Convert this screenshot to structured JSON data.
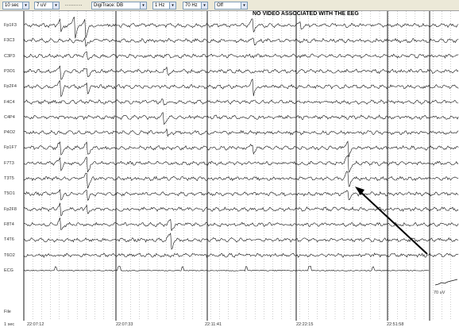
{
  "toolbar": {
    "sensitivity": "10 sec",
    "gain": "7 uV",
    "dotted_setting": "..........",
    "montage": "DigiTrace: DB",
    "low_filter": "1 Hz",
    "high_filter": "70 Hz",
    "notch": "Off"
  },
  "notice": "NO VIDEO ASSOCIATED WITH THE EEG",
  "channels": [
    "Fp1F3",
    "F3C3",
    "C3P3",
    "P3O1",
    "Fp2F4",
    "F4C4",
    "C4P4",
    "P4O2",
    "Fp1F7",
    "F7T3",
    "T3T5",
    "T5O1",
    "Fp2F8",
    "F8T4",
    "T4T6",
    "T6O2",
    "ECG"
  ],
  "bottom_labels": {
    "file": "File",
    "time": "1 sec"
  },
  "timestamps": [
    "22:07:12",
    "22:07:33",
    "22:11:41",
    "22:22:15",
    "22:51:58"
  ],
  "scale_label": "70 uV",
  "colors": {
    "trace": "#111111",
    "grid": "#9a9a9a",
    "divider": "#000000",
    "arrow": "#000000"
  }
}
